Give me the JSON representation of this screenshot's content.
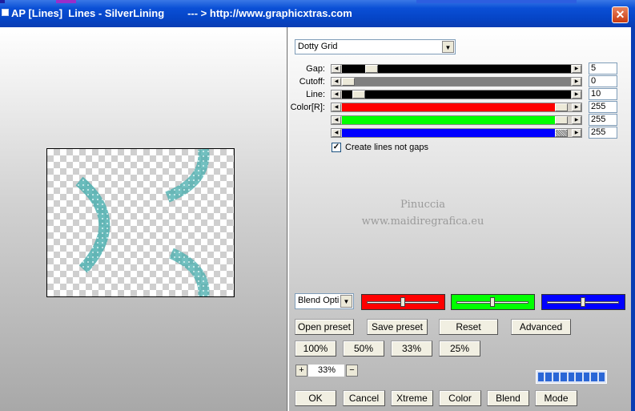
{
  "window": {
    "title": "AP [Lines]  Lines - SilverLining        --- > http://www.graphicxtras.com",
    "close_glyph": "✕"
  },
  "mode_select": {
    "value": "Dotty Grid"
  },
  "sliders": [
    {
      "label": "Gap:",
      "value": "5",
      "fill_color": "#000000",
      "fraction": 0.05
    },
    {
      "label": "Cutoff:",
      "value": "0",
      "fill_color": "#808080",
      "fraction": 0.0
    },
    {
      "label": "Line:",
      "value": "10",
      "fill_color": "#000000",
      "fraction": 0.02
    },
    {
      "label": "Color[R]:",
      "value": "255",
      "fill_color": "#ff0000",
      "fraction": 1.0
    },
    {
      "label": "",
      "value": "255",
      "fill_color": "#00ff00",
      "fraction": 1.0
    },
    {
      "label": "",
      "value": "255",
      "fill_color": "#0000ff",
      "fraction": 1.0
    }
  ],
  "checkbox": {
    "label": "Create lines not gaps",
    "checked": true,
    "glyph": "✓"
  },
  "watermark": {
    "line1": "Pinuccia",
    "line2": "www.maidiregrafica.eu"
  },
  "blend_select": {
    "value": "Blend Opti"
  },
  "color_boxes": [
    {
      "color": "#ff0000",
      "level": 0.5
    },
    {
      "color": "#00ff00",
      "level": 0.5
    },
    {
      "color": "#0000ff",
      "level": 0.5
    }
  ],
  "buttons": {
    "open_preset": "Open preset",
    "save_preset": "Save preset",
    "reset": "Reset",
    "advanced": "Advanced",
    "zoom_100": "100%",
    "zoom_50": "50%",
    "zoom_33": "33%",
    "zoom_25": "25%",
    "ok": "OK",
    "cancel": "Cancel",
    "xtreme": "Xtreme",
    "color": "Color",
    "blend": "Blend",
    "mode": "Mode"
  },
  "zoom": {
    "plus": "+",
    "minus": "−",
    "value": "33%"
  },
  "progress": {
    "segments": 9
  },
  "colors": {
    "titlebar": "#0544c5",
    "preview_curve": "#5fb8b8"
  }
}
